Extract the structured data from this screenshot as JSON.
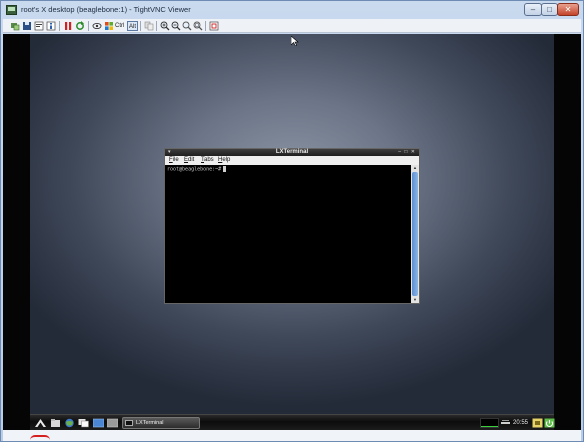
{
  "window": {
    "title": "root's X desktop (beaglebone:1) - TightVNC Viewer",
    "controls": {
      "minimize": "–",
      "maximize": "□",
      "close": "✕"
    }
  },
  "toolbar": {
    "icons": [
      "new-connection-icon",
      "save-icon",
      "options-icon",
      "info-icon",
      "pause-icon",
      "refresh-icon",
      "ctrl-alt-del-icon",
      "win-key-icon"
    ],
    "keys": {
      "ctrl": "Ctrl",
      "alt": "Alt"
    },
    "zoom_icons": [
      "zoom-in-icon",
      "zoom-out-icon",
      "zoom-100-icon",
      "zoom-fit-icon",
      "fullscreen-icon"
    ]
  },
  "terminal": {
    "title": "LXTerminal",
    "window_menu_glyph": "▾",
    "window_controls": "– □ ✕",
    "menus": [
      "File",
      "Edit",
      "Tabs",
      "Help"
    ],
    "prompt": "root@beaglebone:~#"
  },
  "panel": {
    "task_label": "LXTerminal",
    "clock": "20:55"
  },
  "colors": {
    "panel": "#141414",
    "scroll_thumb": "#6f9fd9",
    "terminal_bg": "#000000"
  }
}
